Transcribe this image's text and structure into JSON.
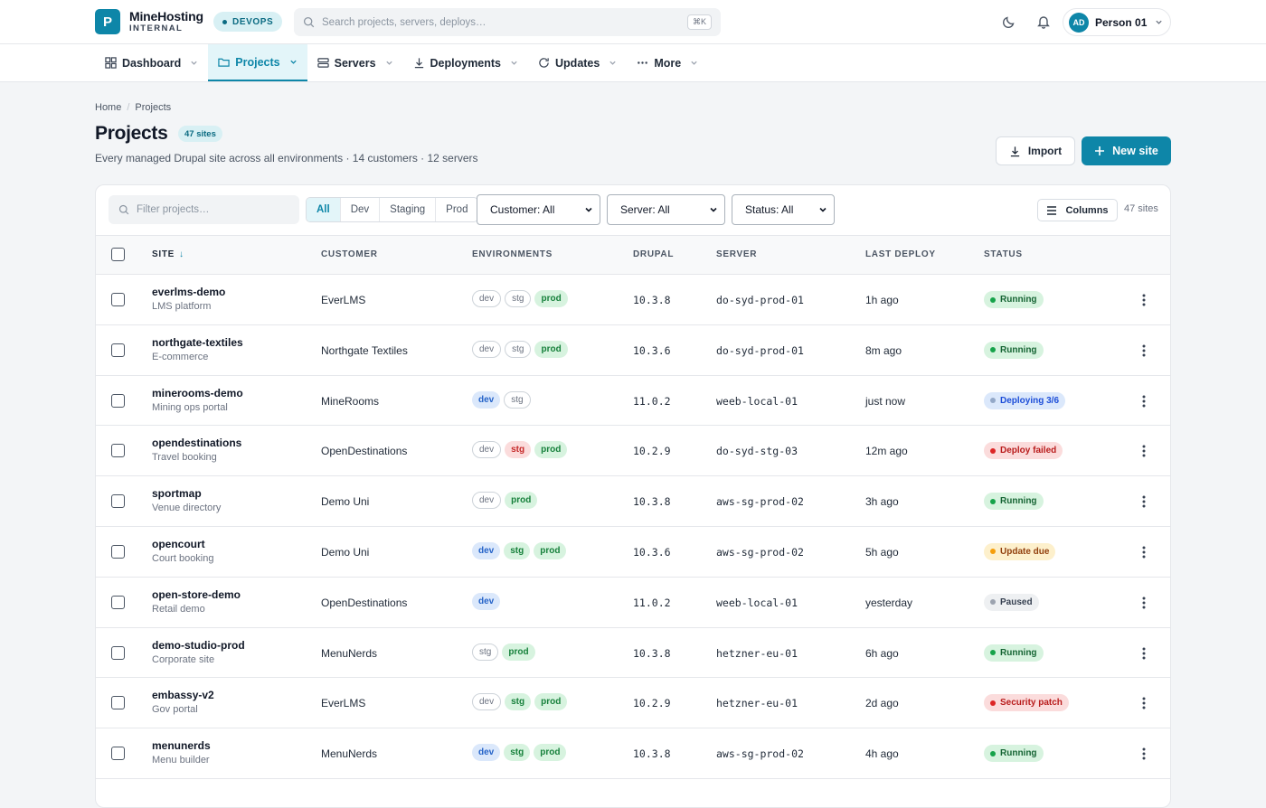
{
  "app": {
    "logo_letter": "P",
    "name": "MineHosting",
    "subtitle": "INTERNAL",
    "env_badge": "DEVOPS",
    "search_placeholder": "Search projects, servers, deploys…",
    "search_shortcut": "⌘K",
    "user_initials": "AD",
    "user_name": "Person 01"
  },
  "nav": [
    {
      "label": "Dashboard",
      "icon": "grid-icon",
      "active": false
    },
    {
      "label": "Projects",
      "icon": "folder-icon",
      "active": true
    },
    {
      "label": "Servers",
      "icon": "server-icon",
      "active": false
    },
    {
      "label": "Deployments",
      "icon": "download-icon",
      "active": false
    },
    {
      "label": "Updates",
      "icon": "refresh-icon",
      "active": false
    },
    {
      "label": "More",
      "icon": "dots-icon",
      "active": false
    }
  ],
  "breadcrumb": {
    "home": "Home",
    "current": "Projects"
  },
  "page": {
    "title": "Projects",
    "count_badge": "47 sites",
    "subtitle": "Every managed Drupal site across all environments · 14 customers · 12 servers",
    "import_label": "Import",
    "new_label": "New site"
  },
  "filters": {
    "placeholder": "Filter projects…",
    "segments": [
      "All",
      "Dev",
      "Staging",
      "Prod"
    ],
    "active_segment": "All",
    "customer": "Customer: All",
    "server": "Server: All",
    "status": "Status: All",
    "columns_label": "Columns",
    "sites_count": "47 sites"
  },
  "columns": {
    "site": "SITE",
    "customer": "CUSTOMER",
    "environments": "ENVIRONMENTS",
    "drupal": "DRUPAL",
    "server": "SERVER",
    "last_deploy": "LAST DEPLOY",
    "status": "STATUS"
  },
  "rows": [
    {
      "name": "everlms-demo",
      "desc": "LMS platform",
      "customer": "EverLMS",
      "envs": [
        {
          "l": "dev",
          "s": "idle"
        },
        {
          "l": "stg",
          "s": "idle"
        },
        {
          "l": "prod",
          "s": "green"
        }
      ],
      "drupal": "10.3.8",
      "server": "do-syd-prod-01",
      "deploy": "1h ago",
      "status": "Running",
      "status_kind": "running"
    },
    {
      "name": "northgate-textiles",
      "desc": "E-commerce",
      "customer": "Northgate Textiles",
      "envs": [
        {
          "l": "dev",
          "s": "idle"
        },
        {
          "l": "stg",
          "s": "idle"
        },
        {
          "l": "prod",
          "s": "green"
        }
      ],
      "drupal": "10.3.6",
      "server": "do-syd-prod-01",
      "deploy": "8m ago",
      "status": "Running",
      "status_kind": "running"
    },
    {
      "name": "minerooms-demo",
      "desc": "Mining ops portal",
      "customer": "MineRooms",
      "envs": [
        {
          "l": "dev",
          "s": "blue"
        },
        {
          "l": "stg",
          "s": "idle"
        }
      ],
      "drupal": "11.0.2",
      "server": "weeb-local-01",
      "deploy": "just now",
      "status": "Deploying 3/6",
      "status_kind": "deploying"
    },
    {
      "name": "opendestinations",
      "desc": "Travel booking",
      "customer": "OpenDestinations",
      "envs": [
        {
          "l": "dev",
          "s": "idle"
        },
        {
          "l": "stg",
          "s": "red"
        },
        {
          "l": "prod",
          "s": "green"
        }
      ],
      "drupal": "10.2.9",
      "server": "do-syd-stg-03",
      "deploy": "12m ago",
      "status": "Deploy failed",
      "status_kind": "failed"
    },
    {
      "name": "sportmap",
      "desc": "Venue directory",
      "customer": "Demo Uni",
      "envs": [
        {
          "l": "dev",
          "s": "idle"
        },
        {
          "l": "prod",
          "s": "green"
        }
      ],
      "drupal": "10.3.8",
      "server": "aws-sg-prod-02",
      "deploy": "3h ago",
      "status": "Running",
      "status_kind": "running"
    },
    {
      "name": "opencourt",
      "desc": "Court booking",
      "customer": "Demo Uni",
      "envs": [
        {
          "l": "dev",
          "s": "blue"
        },
        {
          "l": "stg",
          "s": "green"
        },
        {
          "l": "prod",
          "s": "green"
        }
      ],
      "drupal": "10.3.6",
      "server": "aws-sg-prod-02",
      "deploy": "5h ago",
      "status": "Update due",
      "status_kind": "update"
    },
    {
      "name": "open-store-demo",
      "desc": "Retail demo",
      "customer": "OpenDestinations",
      "envs": [
        {
          "l": "dev",
          "s": "blue"
        }
      ],
      "drupal": "11.0.2",
      "server": "weeb-local-01",
      "deploy": "yesterday",
      "status": "Paused",
      "status_kind": "paused"
    },
    {
      "name": "demo-studio-prod",
      "desc": "Corporate site",
      "customer": "MenuNerds",
      "envs": [
        {
          "l": "stg",
          "s": "idle"
        },
        {
          "l": "prod",
          "s": "green"
        }
      ],
      "drupal": "10.3.8",
      "server": "hetzner-eu-01",
      "deploy": "6h ago",
      "status": "Running",
      "status_kind": "running"
    },
    {
      "name": "embassy-v2",
      "desc": "Gov portal",
      "customer": "EverLMS",
      "envs": [
        {
          "l": "dev",
          "s": "idle"
        },
        {
          "l": "stg",
          "s": "green"
        },
        {
          "l": "prod",
          "s": "green"
        }
      ],
      "drupal": "10.2.9",
      "server": "hetzner-eu-01",
      "deploy": "2d ago",
      "status": "Security patch",
      "status_kind": "failed"
    },
    {
      "name": "menunerds",
      "desc": "Menu builder",
      "customer": "MenuNerds",
      "envs": [
        {
          "l": "dev",
          "s": "blue"
        },
        {
          "l": "stg",
          "s": "green"
        },
        {
          "l": "prod",
          "s": "green"
        }
      ],
      "drupal": "10.3.8",
      "server": "aws-sg-prod-02",
      "deploy": "4h ago",
      "status": "Running",
      "status_kind": "running"
    }
  ],
  "colors": {
    "accent": "#0e86a8"
  }
}
